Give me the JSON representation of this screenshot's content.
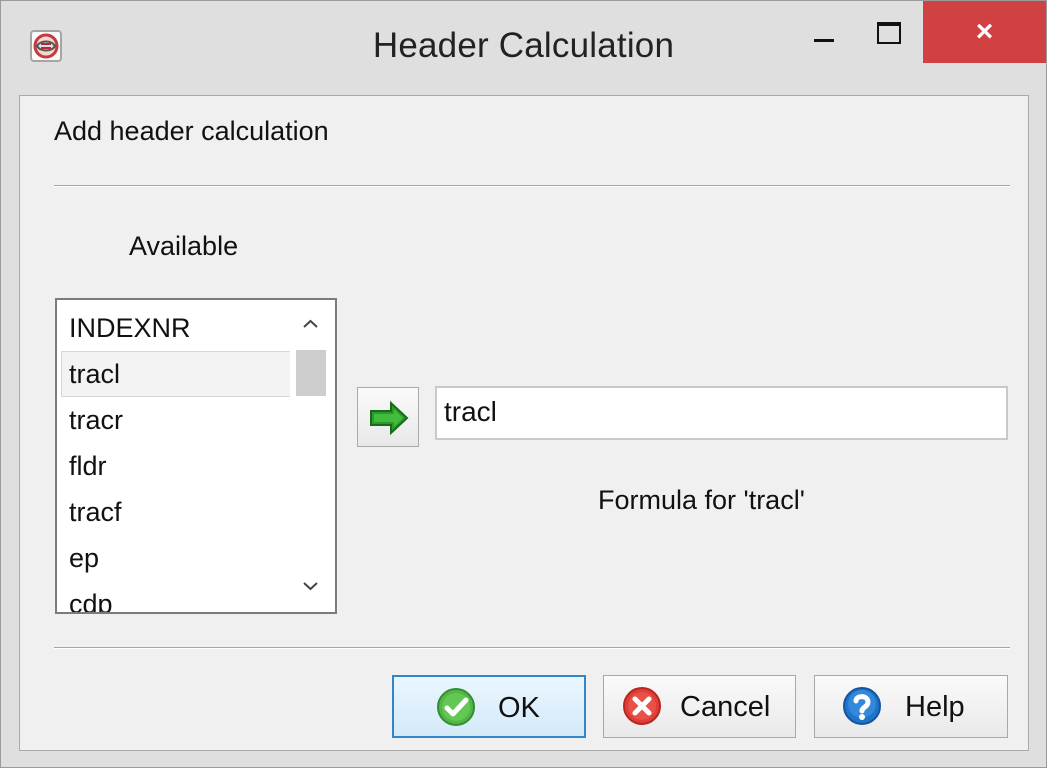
{
  "window": {
    "title": "Header Calculation",
    "close_label": "×"
  },
  "dialog": {
    "heading": "Add header calculation",
    "available_label": "Available",
    "available_items": [
      "INDEXNR",
      "tracl",
      "tracr",
      "fldr",
      "tracf",
      "ep",
      "cdp"
    ],
    "selected_item": "tracl",
    "formula_value": "tracl",
    "formula_label": "Formula for 'tracl'",
    "buttons": {
      "ok": "OK",
      "cancel": "Cancel",
      "help": "Help"
    }
  },
  "icons": {
    "app": "seismic-app-icon",
    "minimize": "minimize-icon",
    "maximize": "maximize-icon",
    "close": "close-icon",
    "add_to_formula": "green-right-arrow-icon",
    "ok": "check-icon",
    "cancel": "cancel-icon",
    "help": "help-icon",
    "scroll_up": "chevron-up-icon",
    "scroll_down": "chevron-down-icon"
  },
  "colors": {
    "title_close_background": "#cf4142",
    "ok_button_border": "#3385c9",
    "arrow_green": "#2a9b2a",
    "check_green": "#55b647",
    "cancel_red": "#df3d35",
    "help_blue": "#1f73c8"
  }
}
